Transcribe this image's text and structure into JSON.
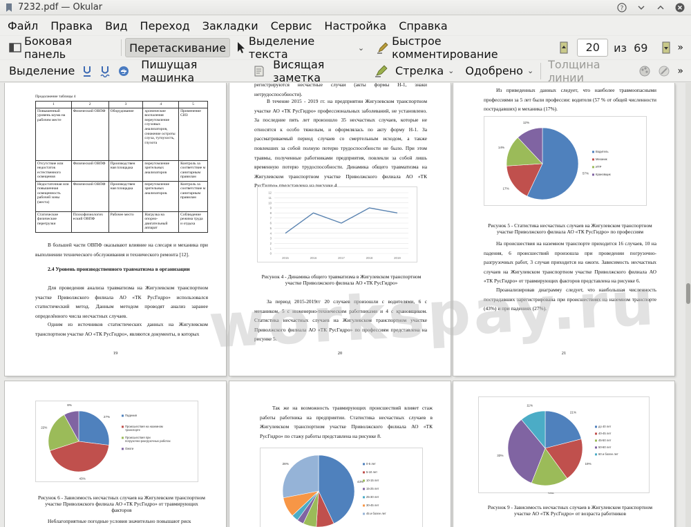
{
  "window": {
    "title": "7232.pdf — Okular"
  },
  "menu": [
    "Файл",
    "Правка",
    "Вид",
    "Переход",
    "Закладки",
    "Сервис",
    "Настройка",
    "Справка"
  ],
  "toolbar1": {
    "sidebar": "Боковая панель",
    "drag": "Перетаскивание",
    "text_select": "Выделение текста",
    "quick_comment": "Быстрое комментирование",
    "page_current": "20",
    "page_of": "из",
    "page_total": "69"
  },
  "toolbar2": {
    "selection": "Выделение",
    "typewriter": "Пишущая машинка",
    "sticky_note": "Висящая заметка",
    "arrow": "Стрелка",
    "approved": "Одобрено",
    "line_width": "Толщина линии"
  },
  "watermark": "workspay.ru",
  "pages": {
    "p19": {
      "table_caption": "Продолжение таблицы 4",
      "table_header": [
        "1",
        "2",
        "3",
        "4",
        "5"
      ],
      "table_rows": [
        [
          "Повышенный уровень шума на рабочем месте",
          "Физический ОВПФ",
          "Оборудование",
          "хронические воспаления переутомление слуховых анализаторов, снижение остроты слуха, тугоухость, глухота",
          "Применение СИЗ"
        ],
        [
          "Отсутствие или недостаток естественного освещения",
          "Физический ОВПФ",
          "Производствен ная площадка",
          "переутомление зрительных анализаторов",
          "Контроль за соответствие м санитарным правилам"
        ],
        [
          "Недостаточная или повышенная освещенность рабочей зоны (места)",
          "Физический ОВПФ",
          "Производствен ная площадка",
          "переутомление зрительных анализаторов.",
          "Контроль за соответствие м санитарным правилам"
        ],
        [
          "Статические физические перегрузки",
          "Психофизиологич еский ОВПФ",
          "Рабочее место",
          "Нагрузка на опорно-двигательный аппарат",
          "Соблюдение режима труда и отдыха"
        ]
      ],
      "para1": "В большей части ОВПФ оказывают влияние на слесаря и механика при выполнении технического обслуживания и технического ремонта [12].",
      "heading": "2.4 Уровень производственного травматизма в организации",
      "para2": "Для проведения анализа травматизма на Жигулевском транспортном участке Приволжского филиала АО «ТК РусГидро» использовался статистический метод. Данным методом проводят анализ заранее определённого числа несчастных случаев.",
      "para3": "Одним из источников статистических данных на Жигулевском транспортном участке АО «ТК РусГидро», являются документы, в которых",
      "num": "19"
    },
    "p20": {
      "para0": "регистрируются несчастные случаи (акты формы Н-1, знаки нетрудоспособности).",
      "para1": "В течение 2015 - 2019 гг. на предприятии Жигулевском транспортном участке АО «ТК РусГидро» профессиональных заболеваний, не установлено. За последние пять лет произошло 35 несчастных случаев, которые не относятся к особо тяжелым, и оформлялась по акту форму Н-1. За рассматриваемый период случаев со смертельным исходом, а также повлекших за собой полную потерю трудоспособности не было. При этом травмы, полученные работниками предприятия, повлекли за собой лишь временную потерю трудоспособности. Динамика общего травматизма на Жигулевском транспортном участке Приволжского филиала АО «ТК РусГидро» представлена на рисунке 4.",
      "caption": "Рисунок 4 - Динамика общего травматизма в Жигулевском транспортном участке Приволжского филиала АО «ТК РусГидро»",
      "para2": "За период 2015-2019гг 20 случаев произошли с водителями, 6 с механиком, 5 с инженерно-техническим работниками и 4 с крановщиком. Статистика несчастных случаев на Жигулевском транспортном участке Приволжского филиала АО «ТК РусГидро» по профессиям представлена на рисунке 5.",
      "num": "20"
    },
    "p21": {
      "para0": "Из приведенных данных следует, что наиболее травмоопасными профессиями за 5 лет были профессии: водителя (57 % от общей численности пострадавших) и механика (17%).",
      "caption": "Рисунок 5 - Статистика несчастных случаев на Жигулевском транспортном участке Приволжского филиала АО «ТК РусГидро» по профессиям",
      "para1": "На происшествия на наземном транспорте приходится 16 случаев, 10 на падения, 6 происшествий произошла при проведении погрузочно-разгрузочных работ, 3 случая приходится на ожоги. Зависимость несчастных случаев на Жигулевском транспортном участке Приволжского филиала АО «ТК РусГидро» от травмирующих факторов представлена на рисунке 6.",
      "para2": "Проанализировав диаграмму следует, что наибольшая численность пострадавших зарегистрирована при происшествиях на наземном транспорте (43%) и при падениях (27%).",
      "num": "21"
    },
    "p22": {
      "caption": "Рисунок 6 - Зависимость несчастных случаев на Жигулевском транспортном участке Приволжского филиала АО «ТК РусГидро» от травмирующих факторов",
      "para0": "Неблагоприятные погодные условия значительно повышают риск"
    },
    "p23": {
      "para0": "Так же на возможность травмирующих происшествий влияет стаж работы работника на предприятии. Статистика несчастных случаев в Жигулевском транспортном участке Приволжского филиала АО «ТК РусГидро» по стажу работы представлена на рисунке 8."
    },
    "p24": {
      "caption": "Рисунок 9 - Зависимость несчастных случаев в Жигулевском транспортном участке АО «ТК РусГидро» от возраста работников"
    }
  },
  "chart_data": [
    {
      "type": "line",
      "x": [
        "2015",
        "2016",
        "2017",
        "2018",
        "2019"
      ],
      "series": [
        {
          "values": [
            4,
            8,
            6,
            9,
            8
          ]
        }
      ],
      "ylim": [
        0,
        12
      ],
      "yticks": [
        "0",
        "1",
        "2",
        "3",
        "4",
        "5",
        "6",
        "7",
        "8",
        "9",
        "10",
        "11",
        "12"
      ],
      "color": "#5b84b1"
    },
    {
      "type": "pie",
      "labels": [
        "Водитель",
        "Механик",
        "ИТР",
        "Крановщик"
      ],
      "values": [
        57,
        17,
        14,
        12
      ],
      "value_labels": [
        "57%",
        "17%",
        "14%",
        "12%"
      ],
      "colors": [
        "#4f81bd",
        "#c0504d",
        "#9bbb59",
        "#8064a2"
      ]
    },
    {
      "type": "pie",
      "labels": [
        "Падения",
        "Происшествия на наземном транспорте",
        "Происшествия при погрузочно-разгрузочных работах",
        "Ожоги"
      ],
      "values": [
        27,
        43,
        22,
        8
      ],
      "value_labels": [
        "27%",
        "43%",
        "22%",
        "8%"
      ],
      "colors": [
        "#4f81bd",
        "#c0504d",
        "#9bbb59",
        "#8064a2"
      ]
    },
    {
      "type": "pie",
      "labels": [
        "0-5 лет",
        "5-10 лет",
        "10-15 лет",
        "15-25 лет",
        "25-30 лет",
        "30-45 лет",
        "45 и более лет"
      ],
      "values": [
        43,
        8,
        6,
        3,
        3,
        9,
        28
      ],
      "value_labels": [
        "43%",
        "8%",
        "6%",
        "",
        "",
        "",
        "28%"
      ],
      "colors": [
        "#4f81bd",
        "#c0504d",
        "#9bbb59",
        "#8064a2",
        "#4bacc6",
        "#f79646",
        "#95b3d7"
      ]
    },
    {
      "type": "pie",
      "labels": [
        "до 40 лет",
        "40-45 лет",
        "45-50 лет",
        "50-60 лет",
        "60 и более лет"
      ],
      "values": [
        21,
        19,
        16,
        33,
        11
      ],
      "value_labels": [
        "21%",
        "19%",
        "16%",
        "33%",
        "11%"
      ],
      "colors": [
        "#4f81bd",
        "#c0504d",
        "#9bbb59",
        "#8064a2",
        "#4bacc6"
      ]
    }
  ]
}
